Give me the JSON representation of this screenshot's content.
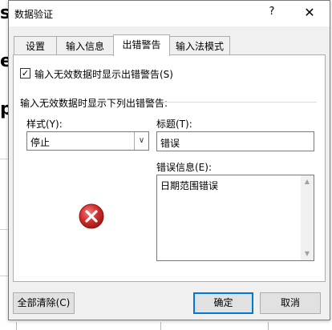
{
  "background_sheet": {
    "fragment_chars": [
      "s",
      "e",
      "p"
    ]
  },
  "dialog": {
    "title": "数据验证",
    "help_symbol": "?",
    "close_symbol": "✕"
  },
  "tabs": [
    {
      "label": "设置",
      "active": false
    },
    {
      "label": "输入信息",
      "active": false
    },
    {
      "label": "出错警告",
      "active": true
    },
    {
      "label": "输入法模式",
      "active": false
    }
  ],
  "error_alert": {
    "show_alert_checkbox": {
      "checked": true,
      "label": "输入无效数据时显示出错警告(S)"
    },
    "group_label": "输入无效数据时显示下列出错警告:",
    "style_label": "样式(Y):",
    "style_value": "停止",
    "title_label": "标题(T):",
    "title_value": "错误",
    "message_label": "错误信息(E):",
    "message_value": "日期范围错误",
    "icon": "error-stop-icon",
    "icon_color": "#d32f2f"
  },
  "buttons": {
    "clear_all": "全部清除(C)",
    "ok": "确定",
    "cancel": "取消"
  }
}
